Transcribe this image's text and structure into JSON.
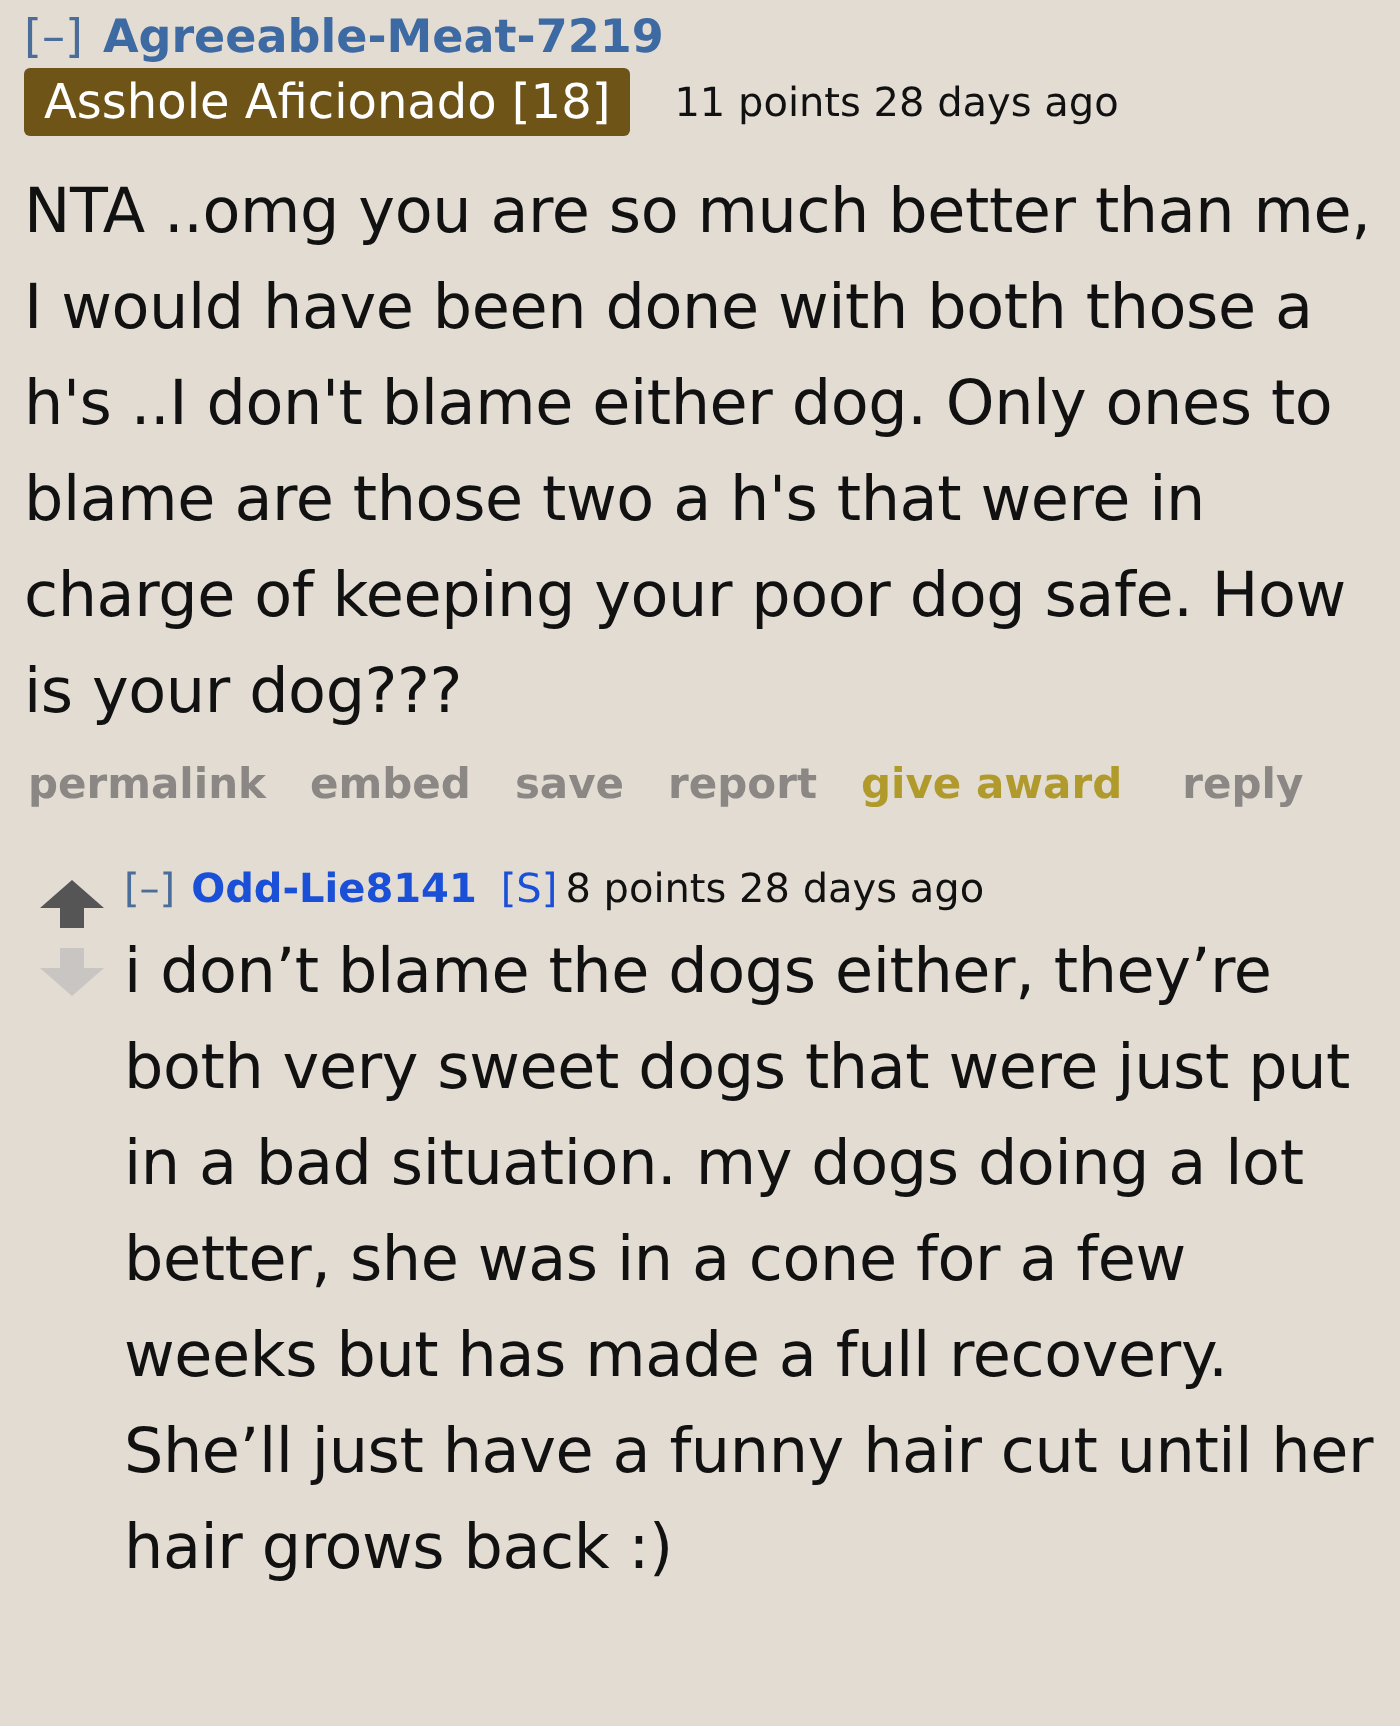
{
  "comment": {
    "collapse": "[–]",
    "author": "Agreeable-Meat-7219",
    "flair": "Asshole Aficionado [18]",
    "meta": "11 points 28 days ago",
    "body": "NTA ..omg you are so much better than me, I would have been done with both those a h's ..I don't blame either dog. Only ones to blame are those two a h's that were in charge of keeping your poor dog safe. How is your dog???",
    "actions": [
      {
        "label": "permalink",
        "kind": "plain"
      },
      {
        "label": "embed",
        "kind": "plain"
      },
      {
        "label": "save",
        "kind": "plain"
      },
      {
        "label": "report",
        "kind": "plain"
      },
      {
        "label": "give award",
        "kind": "award"
      },
      {
        "label": "reply",
        "kind": "plain"
      }
    ]
  },
  "reply": {
    "upvoted": true,
    "downvoted": false,
    "collapse": "[–]",
    "author": "Odd-Lie8141",
    "submitter": "[S]",
    "meta": "8 points 28 days ago",
    "body": "i don’t blame the dogs either, they’re both very sweet dogs that were just put in a bad situation. my dogs doing a lot better, she was in a cone for a few weeks but has made a full recovery. She’ll just have a funny hair cut until her hair grows back :)"
  }
}
